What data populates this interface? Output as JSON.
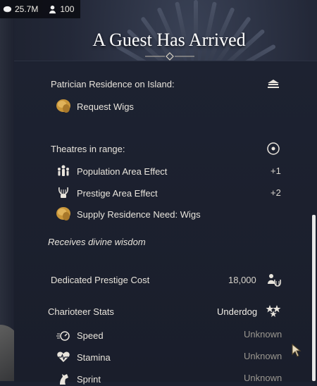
{
  "resources": {
    "gold": "25.7M",
    "workforce": "100"
  },
  "dialog": {
    "title": "A Guest Has Arrived"
  },
  "residence": {
    "header": "Patrician Residence on Island:",
    "request": "Request Wigs"
  },
  "theatres": {
    "header": "Theatres in range:",
    "effects": [
      {
        "label": "Population Area Effect",
        "value": "+1"
      },
      {
        "label": "Prestige Area Effect",
        "value": "+2"
      },
      {
        "label": "Supply Residence Need: Wigs",
        "value": ""
      }
    ]
  },
  "wisdom": "Receives divine wisdom",
  "prestige": {
    "label": "Dedicated Prestige Cost",
    "value": "18,000"
  },
  "charioteer": {
    "label": "Charioteer Stats",
    "rank": "Underdog",
    "stats": [
      {
        "label": "Speed",
        "value": "Unknown"
      },
      {
        "label": "Stamina",
        "value": "Unknown"
      },
      {
        "label": "Sprint",
        "value": "Unknown"
      }
    ]
  },
  "colors": {
    "panel": "#1d2231",
    "text": "#e8e4dc",
    "accent_gold": "#c9963a"
  }
}
